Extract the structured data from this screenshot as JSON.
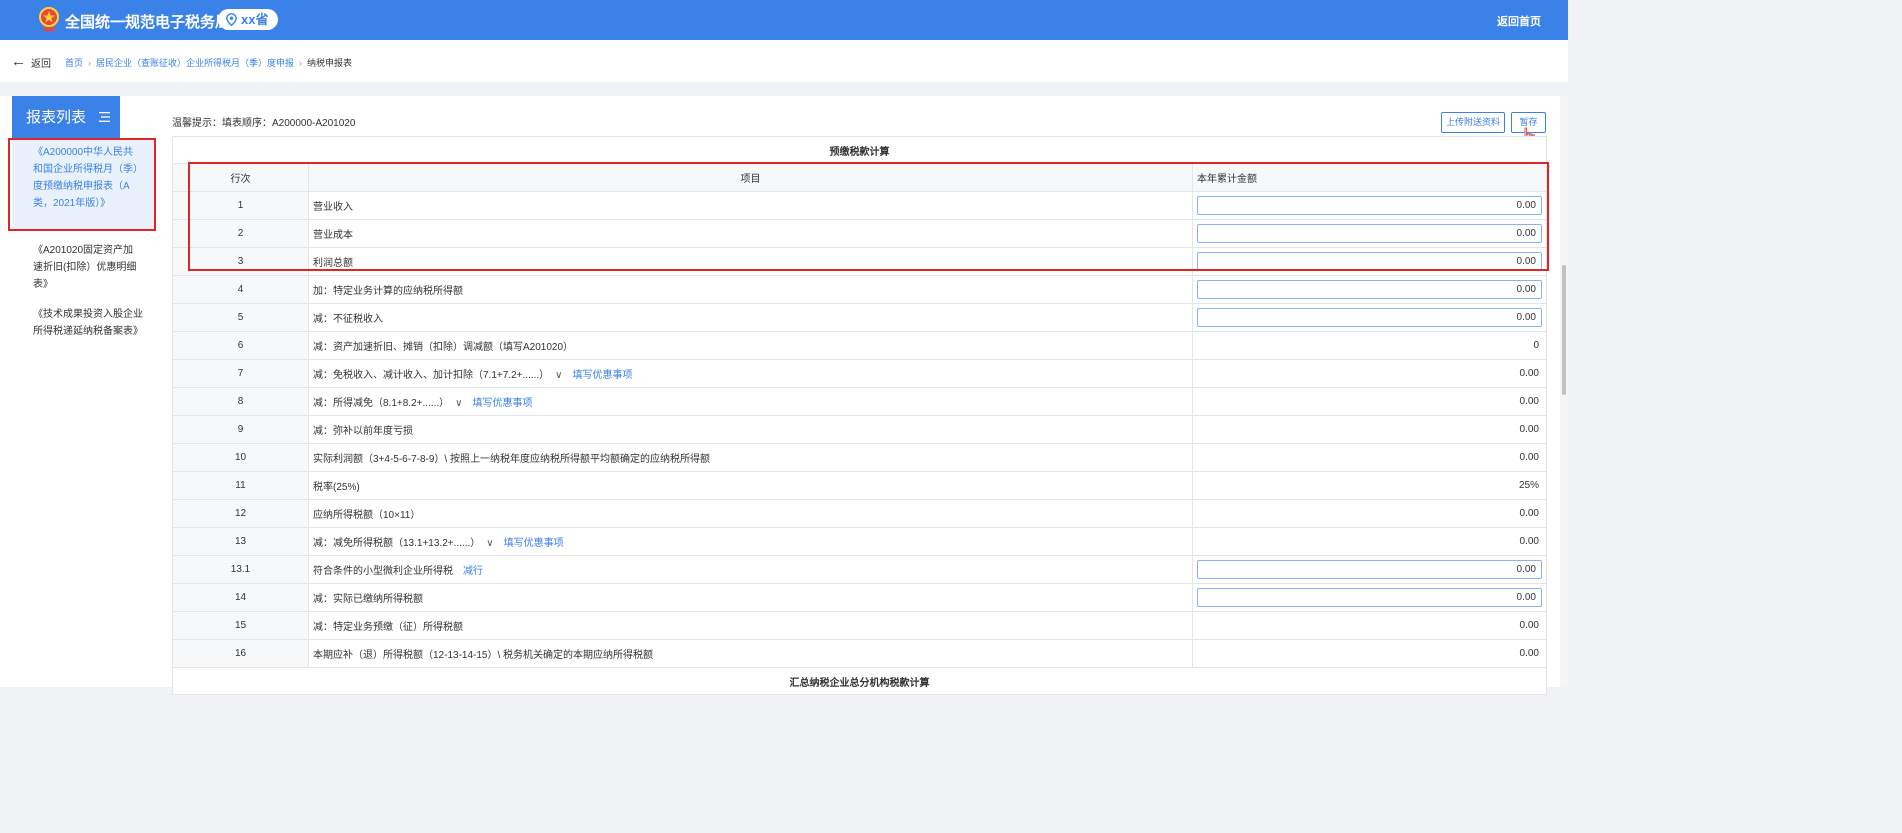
{
  "header": {
    "site_title": "全国统一规范电子税务局",
    "province": "xx省",
    "home_link": "返回首页"
  },
  "breadcrumb": {
    "back_label": "返回",
    "items": [
      "首页",
      "居民企业（查账征收）企业所得税月（季）度申报",
      "纳税申报表"
    ]
  },
  "sidebar": {
    "title": "报表列表",
    "items": [
      {
        "label": "《A200000中华人民共和国企业所得税月（季）度预缴纳税申报表（A类，2021年版）》",
        "active": true
      },
      {
        "label": "《A201020固定资产加速折旧(扣除）优惠明细表》",
        "active": false
      },
      {
        "label": "《技术成果投资入股企业所得税递延纳税备案表》",
        "active": false
      }
    ]
  },
  "toolbar": {
    "hint": "温馨提示：填表顺序：A200000-A201020",
    "upload_label": "上传附送资料",
    "save_label": "暂存"
  },
  "table": {
    "section_title": "预缴税款计算",
    "headers": [
      "行次",
      "项目",
      "本年累计金额"
    ],
    "rows": [
      {
        "no": "1",
        "item": "营业收入",
        "amount": "0.00",
        "editable": true
      },
      {
        "no": "2",
        "item": "营业成本",
        "amount": "0.00",
        "editable": true
      },
      {
        "no": "3",
        "item": "利润总额",
        "amount": "0.00",
        "editable": true
      },
      {
        "no": "4",
        "item": "加：特定业务计算的应纳税所得额",
        "amount": "0.00",
        "editable": true
      },
      {
        "no": "5",
        "item": "减：不征税收入",
        "amount": "0.00",
        "editable": true
      },
      {
        "no": "6",
        "item": "减：资产加速折旧、摊销（扣除）调减额（填写A201020）",
        "amount": "0",
        "editable": false
      },
      {
        "no": "7",
        "item": "减：免税收入、减计收入、加计扣除（7.1+7.2+......）",
        "amount": "0.00",
        "editable": false,
        "dropdown": true,
        "link": "填写优惠事项"
      },
      {
        "no": "8",
        "item": "减：所得减免（8.1+8.2+......）",
        "amount": "0.00",
        "editable": false,
        "dropdown": true,
        "link": "填写优惠事项"
      },
      {
        "no": "9",
        "item": "减：弥补以前年度亏损",
        "amount": "0.00",
        "editable": false
      },
      {
        "no": "10",
        "item": "实际利润额（3+4-5-6-7-8-9）\\ 按照上一纳税年度应纳税所得额平均额确定的应纳税所得额",
        "amount": "0.00",
        "editable": false
      },
      {
        "no": "11",
        "item": "税率(25%)",
        "amount": "25%",
        "editable": false
      },
      {
        "no": "12",
        "item": "应纳所得税额（10×11）",
        "amount": "0.00",
        "editable": false
      },
      {
        "no": "13",
        "item": "减：减免所得税额（13.1+13.2+......）",
        "amount": "0.00",
        "editable": false,
        "dropdown": true,
        "link": "填写优惠事项"
      },
      {
        "no": "13.1",
        "item": "符合条件的小型微利企业所得税",
        "amount": "0.00",
        "editable": true,
        "link": "减行"
      },
      {
        "no": "14",
        "item": "减：实际已缴纳所得税额",
        "amount": "0.00",
        "editable": true
      },
      {
        "no": "15",
        "item": "减：特定业务预缴（征）所得税额",
        "amount": "0.00",
        "editable": false
      },
      {
        "no": "16",
        "item": "本期应补（退）所得税额（12-13-14-15）\\ 税务机关确定的本期应纳所得税额",
        "amount": "0.00",
        "editable": false
      }
    ],
    "next_section_title": "汇总纳税企业总分机构税款计算"
  }
}
